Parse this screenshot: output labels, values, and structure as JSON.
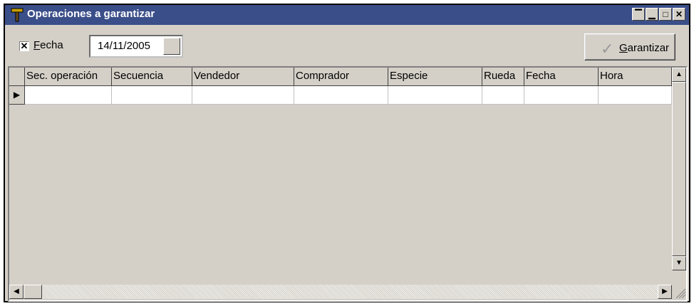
{
  "window": {
    "title": "Operaciones a garantizar"
  },
  "titlebar_buttons": [
    {
      "name": "restore",
      "glyph": "▔"
    },
    {
      "name": "minimize",
      "glyph": "▁"
    },
    {
      "name": "maximize",
      "glyph": "□"
    },
    {
      "name": "close",
      "glyph": "✕"
    }
  ],
  "toolbar": {
    "fecha_checkbox": {
      "checked": true,
      "mark": "✕"
    },
    "fecha_label": "Fecha",
    "date_value": "14/11/2005",
    "garantizar_label": "Garantizar",
    "garantizar_icon": "✓"
  },
  "grid": {
    "columns": [
      "Sec. operación",
      "Secuencia",
      "Vendedor",
      "Comprador",
      "Especie",
      "Rueda",
      "Fecha",
      "Hora"
    ],
    "row_indicator": "▶",
    "scroll": {
      "up": "▲",
      "down": "▼",
      "left": "◀",
      "right": "▶"
    }
  }
}
